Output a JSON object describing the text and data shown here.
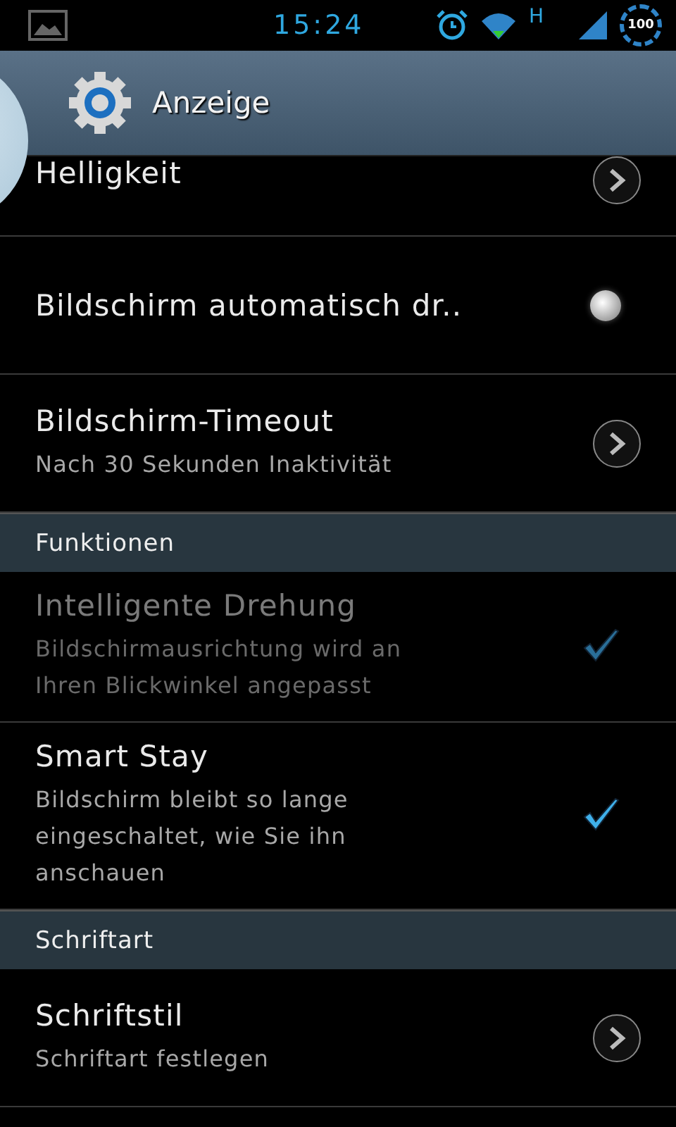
{
  "status_bar": {
    "time": "15:24",
    "network": "H",
    "battery": "100"
  },
  "header": {
    "title": "Anzeige"
  },
  "sections": [
    {
      "items": [
        {
          "kind": "link",
          "title": "Helligkeit"
        },
        {
          "kind": "toggle",
          "title": "Bildschirm automatisch dr..",
          "on": false
        },
        {
          "kind": "link",
          "title": "Bildschirm-Timeout",
          "summary": "Nach 30 Sekunden Inaktivität"
        }
      ]
    },
    {
      "heading": "Funktionen",
      "items": [
        {
          "kind": "check",
          "title": "Intelligente Drehung",
          "summary": "Bildschirmausrichtung wird an Ihren Blickwinkel angepasst",
          "checked": true,
          "disabled": true
        },
        {
          "kind": "check",
          "title": "Smart Stay",
          "summary": "Bildschirm bleibt so lange eingeschaltet, wie Sie ihn anschauen",
          "checked": true,
          "disabled": false
        }
      ]
    },
    {
      "heading": "Schriftart",
      "items": [
        {
          "kind": "link",
          "title": "Schriftstil",
          "summary": "Schriftart festlegen"
        }
      ]
    }
  ]
}
